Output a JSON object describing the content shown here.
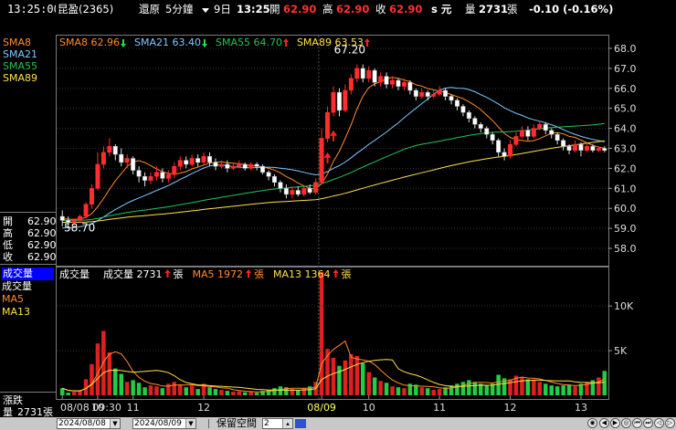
{
  "window": {
    "time": "13:25:00"
  },
  "header": {
    "stock": "昆盈(2365)",
    "restore_label": "還原",
    "period": "5分鐘",
    "day": "9日",
    "time": "13:25",
    "open_label": "開",
    "open": "62.90",
    "high_label": "高",
    "high": "62.90",
    "close_label": "收",
    "close": "62.90",
    "unit": "s 元",
    "volume_label": "量",
    "volume": "2731",
    "volume_unit": "張",
    "change": "-0.10 (-0.16%)"
  },
  "price_panel": {
    "indicators": [
      {
        "name": "SMA8",
        "value": "62.96",
        "arrow": "down",
        "color": "#ff8c2a"
      },
      {
        "name": "SMA21",
        "value": "63.40",
        "arrow": "down",
        "color": "#7fc8ff"
      },
      {
        "name": "SMA55",
        "value": "64.70",
        "arrow": "up",
        "color": "#22c35a"
      },
      {
        "name": "SMA89",
        "value": "63.53",
        "arrow": "up",
        "color": "#ffe14a"
      }
    ],
    "high_mark": "67.20",
    "low_mark": "58.70",
    "y_ticks": [
      "68.0",
      "67.0",
      "66.0",
      "65.0",
      "64.0",
      "63.0",
      "62.0",
      "61.0",
      "60.0",
      "59.0",
      "58.0"
    ]
  },
  "quote_box": {
    "rows": [
      {
        "label": "開",
        "value": "62.90"
      },
      {
        "label": "高",
        "value": "62.90"
      },
      {
        "label": "低",
        "value": "62.90"
      },
      {
        "label": "收",
        "value": "62.90"
      }
    ]
  },
  "volume_panel": {
    "left_items": [
      {
        "text": "成交量",
        "selected": true,
        "color": "#ffffff"
      },
      {
        "text": "成交量",
        "selected": false,
        "color": "#ffffff"
      },
      {
        "text": "MA5",
        "selected": false,
        "color": "#ff8c2a"
      },
      {
        "text": "MA13",
        "selected": false,
        "color": "#ffe14a"
      }
    ],
    "title": "成交量",
    "vol_label": "成交量",
    "vol_value": "2731",
    "vol_unit": "張",
    "ma5_label": "MA5",
    "ma5_value": "1972",
    "ma5_unit": "張",
    "ma13_label": "MA13",
    "ma13_value": "1364",
    "ma13_unit": "張",
    "y_ticks": [
      "10K",
      "5K"
    ]
  },
  "bottom_left": {
    "label": "漲跌",
    "vol_label": "量",
    "vol_value": "2731張"
  },
  "x_axis": [
    {
      "text": "08/08 09:30",
      "color": "#dddddd"
    },
    {
      "text": "10",
      "color": "#dddddd"
    },
    {
      "text": "11",
      "color": "#dddddd"
    },
    {
      "text": "12",
      "color": "#dddddd"
    },
    {
      "text": "08/09",
      "color": "#ffff66"
    },
    {
      "text": "10",
      "color": "#dddddd"
    },
    {
      "text": "11",
      "color": "#dddddd"
    },
    {
      "text": "12",
      "color": "#dddddd"
    },
    {
      "text": "13",
      "color": "#dddddd"
    }
  ],
  "toolbar": {
    "date_from": "2024/08/08",
    "date_to": "2024/08/09",
    "keep_space_label": "保留空間",
    "keep_space_value": "2"
  },
  "chart_data": {
    "type": "candlestick",
    "title": "昆盈(2365) 5分鐘",
    "sessions": [
      "08/08",
      "08/09"
    ],
    "price_ylim": [
      57.5,
      68.5
    ],
    "volume_ylim": [
      0,
      14000
    ],
    "candles": [
      [
        59.6,
        59.4,
        59.9,
        59.1,
        800
      ],
      [
        59.4,
        59.3,
        59.6,
        59.0,
        300
      ],
      [
        59.3,
        59.4,
        59.5,
        59.1,
        400
      ],
      [
        59.4,
        59.6,
        59.7,
        59.3,
        500
      ],
      [
        59.6,
        60.2,
        60.3,
        59.5,
        1800
      ],
      [
        60.2,
        61.0,
        61.2,
        60.0,
        3500
      ],
      [
        61.0,
        62.2,
        62.8,
        60.9,
        5800
      ],
      [
        62.2,
        62.8,
        63.1,
        62.0,
        7200
      ],
      [
        62.8,
        63.1,
        63.5,
        62.6,
        4800
      ],
      [
        63.1,
        62.7,
        63.2,
        62.4,
        3000
      ],
      [
        62.7,
        62.3,
        63.0,
        62.1,
        2400
      ],
      [
        62.3,
        62.5,
        62.7,
        62.0,
        1500
      ],
      [
        62.5,
        61.9,
        62.6,
        61.7,
        1700
      ],
      [
        61.9,
        61.6,
        62.1,
        61.3,
        1400
      ],
      [
        61.6,
        61.4,
        61.8,
        61.1,
        900
      ],
      [
        61.4,
        61.6,
        61.8,
        61.2,
        1100
      ],
      [
        61.6,
        61.8,
        62.1,
        61.4,
        1000
      ],
      [
        61.8,
        61.5,
        62.0,
        61.3,
        800
      ],
      [
        61.5,
        61.7,
        61.9,
        61.3,
        1300
      ],
      [
        61.7,
        62.1,
        62.3,
        61.5,
        1500
      ],
      [
        62.1,
        62.4,
        62.6,
        61.9,
        1200
      ],
      [
        62.4,
        62.2,
        62.6,
        62.0,
        900
      ],
      [
        62.2,
        62.5,
        62.7,
        62.1,
        1100
      ],
      [
        62.5,
        62.3,
        62.7,
        62.1,
        700
      ],
      [
        62.3,
        62.6,
        62.8,
        62.2,
        1300
      ],
      [
        62.6,
        62.3,
        62.8,
        62.1,
        900
      ],
      [
        62.3,
        62.1,
        62.5,
        61.9,
        700
      ],
      [
        62.1,
        62.2,
        62.4,
        62.0,
        600
      ],
      [
        62.2,
        62.0,
        62.4,
        61.8,
        500
      ],
      [
        62.0,
        62.1,
        62.3,
        61.9,
        400
      ],
      [
        62.1,
        62.2,
        62.4,
        62.0,
        450
      ],
      [
        62.2,
        62.0,
        62.3,
        61.9,
        350
      ],
      [
        62.0,
        62.2,
        62.3,
        61.9,
        400
      ],
      [
        62.2,
        62.1,
        62.3,
        61.9,
        300
      ],
      [
        62.1,
        61.8,
        62.2,
        61.7,
        500
      ],
      [
        61.8,
        61.6,
        61.9,
        61.4,
        600
      ],
      [
        61.6,
        61.3,
        61.7,
        61.1,
        800
      ],
      [
        61.3,
        61.0,
        61.4,
        60.8,
        1000
      ],
      [
        61.0,
        60.7,
        61.2,
        60.5,
        900
      ],
      [
        60.7,
        60.9,
        61.1,
        60.5,
        700
      ],
      [
        60.9,
        60.7,
        61.1,
        60.6,
        600
      ],
      [
        60.7,
        61.0,
        61.1,
        60.6,
        800
      ],
      [
        61.0,
        60.8,
        61.2,
        60.7,
        1000
      ],
      [
        60.8,
        61.3,
        61.5,
        60.7,
        1500
      ],
      [
        61.3,
        63.5,
        64.0,
        61.2,
        13800
      ],
      [
        63.5,
        64.8,
        65.1,
        63.3,
        5200
      ],
      [
        64.8,
        65.8,
        66.1,
        64.6,
        4200
      ],
      [
        65.8,
        64.9,
        66.0,
        64.6,
        3300
      ],
      [
        64.9,
        65.9,
        66.2,
        64.8,
        3900
      ],
      [
        65.9,
        66.5,
        66.7,
        65.7,
        4600
      ],
      [
        66.5,
        67.0,
        67.2,
        66.3,
        4400
      ],
      [
        67.0,
        66.5,
        67.2,
        66.3,
        3600
      ],
      [
        66.5,
        66.9,
        67.1,
        66.3,
        2600
      ],
      [
        66.9,
        66.3,
        67.0,
        66.1,
        2000
      ],
      [
        66.3,
        66.6,
        66.8,
        66.1,
        1600
      ],
      [
        66.6,
        66.2,
        66.8,
        66.0,
        1400
      ],
      [
        66.2,
        66.4,
        66.6,
        66.0,
        1000
      ],
      [
        66.4,
        66.1,
        66.5,
        65.9,
        900
      ],
      [
        66.1,
        66.3,
        66.5,
        65.9,
        800
      ],
      [
        66.3,
        65.9,
        66.4,
        65.7,
        1300
      ],
      [
        65.9,
        65.6,
        66.0,
        65.4,
        1200
      ],
      [
        65.6,
        65.8,
        66.0,
        65.5,
        900
      ],
      [
        65.8,
        65.6,
        65.9,
        65.4,
        800
      ],
      [
        65.6,
        65.7,
        65.9,
        65.5,
        600
      ],
      [
        65.7,
        65.9,
        66.1,
        65.6,
        700
      ],
      [
        65.9,
        65.6,
        66.0,
        65.4,
        900
      ],
      [
        65.6,
        65.4,
        65.7,
        65.2,
        1100
      ],
      [
        65.4,
        65.1,
        65.5,
        64.9,
        1300
      ],
      [
        65.1,
        64.8,
        65.2,
        64.6,
        1500
      ],
      [
        64.8,
        64.5,
        64.9,
        64.3,
        1700
      ],
      [
        64.5,
        64.2,
        64.6,
        64.0,
        1500
      ],
      [
        64.2,
        64.0,
        64.3,
        63.8,
        1300
      ],
      [
        64.0,
        63.7,
        64.1,
        63.5,
        1100
      ],
      [
        63.7,
        63.4,
        63.8,
        63.2,
        1300
      ],
      [
        63.4,
        62.8,
        63.5,
        62.6,
        2300
      ],
      [
        62.8,
        62.6,
        63.0,
        62.4,
        1900
      ],
      [
        62.6,
        63.2,
        63.4,
        62.5,
        1800
      ],
      [
        63.2,
        63.6,
        63.8,
        63.1,
        2200
      ],
      [
        63.6,
        63.9,
        64.1,
        63.5,
        2000
      ],
      [
        63.9,
        63.6,
        64.1,
        63.4,
        1800
      ],
      [
        63.6,
        64.0,
        64.2,
        63.5,
        1700
      ],
      [
        64.0,
        64.2,
        64.4,
        63.9,
        1500
      ],
      [
        64.2,
        63.9,
        64.3,
        63.7,
        1300
      ],
      [
        63.9,
        63.7,
        64.0,
        63.5,
        1100
      ],
      [
        63.7,
        63.4,
        63.8,
        63.2,
        1000
      ],
      [
        63.4,
        63.1,
        63.5,
        62.9,
        1100
      ],
      [
        63.1,
        62.9,
        63.2,
        62.7,
        1200
      ],
      [
        62.9,
        63.2,
        63.4,
        62.8,
        1000
      ],
      [
        63.2,
        62.9,
        63.3,
        62.6,
        1300
      ],
      [
        62.9,
        63.1,
        63.3,
        62.8,
        1500
      ],
      [
        63.1,
        62.9,
        63.2,
        62.8,
        1700
      ],
      [
        62.9,
        63.0,
        63.1,
        62.8,
        2000
      ],
      [
        63.0,
        62.9,
        63.1,
        62.8,
        2731
      ]
    ]
  }
}
